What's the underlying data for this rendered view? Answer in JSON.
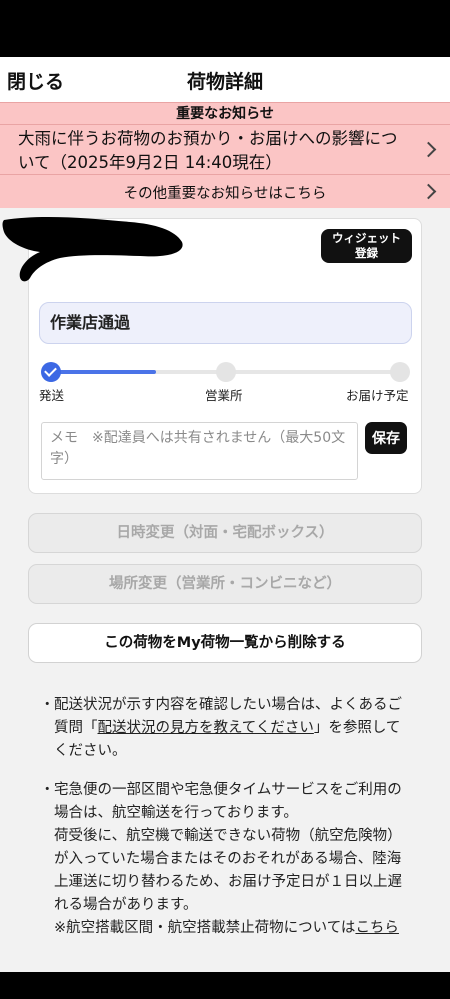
{
  "nav": {
    "close_label": "閉じる",
    "title": "荷物詳細"
  },
  "notice": {
    "heading": "重要なお知らせ",
    "main_text": "大雨に伴うお荷物のお預かり・お届けへの影響について（2025年9月2日 14:40現在）",
    "other_text": "その他重要なお知らせはこちら"
  },
  "package": {
    "widget_label_1": "ウィジェット",
    "widget_label_2": "登録",
    "status": "作業店通過",
    "progress": 0.3,
    "steps": [
      "発送",
      "営業所",
      "お届け予定"
    ],
    "memo_placeholder": "メモ　※配達員へは共有されません（最大50文字）",
    "memo_value": "",
    "save_label": "保存"
  },
  "actions": {
    "change_datetime": "日時変更（対面・宅配ボックス）",
    "change_location": "場所変更（営業所・コンビニなど）",
    "delete": "この荷物をMy荷物一覧から削除する"
  },
  "notes": {
    "bullet": "・",
    "n1_before": "配送状況が示す内容を確認したい場合は、よくあるご質問「",
    "n1_link": "配送状況の見方を教えてください",
    "n1_after": "」を参照してください。",
    "n2_text": "宅急便の一部区間や宅急便タイムサービスをご利用の場合は、航空輸送を行っております。",
    "n2_text2": "荷受後に、航空機で輸送できない荷物（航空危険物）が入っていた場合またはそのおそれがある場合、陸海上運送に切り替わるため、お届け予定日が１日以上遅れる場合があります。",
    "n2_text3": "※航空搭載区間・航空搭載禁止荷物については",
    "n2_link": "こちら"
  },
  "colors": {
    "notice_bg": "#fbc5c5",
    "accent": "#3c68e4",
    "status_bg": "#eef0fb"
  }
}
